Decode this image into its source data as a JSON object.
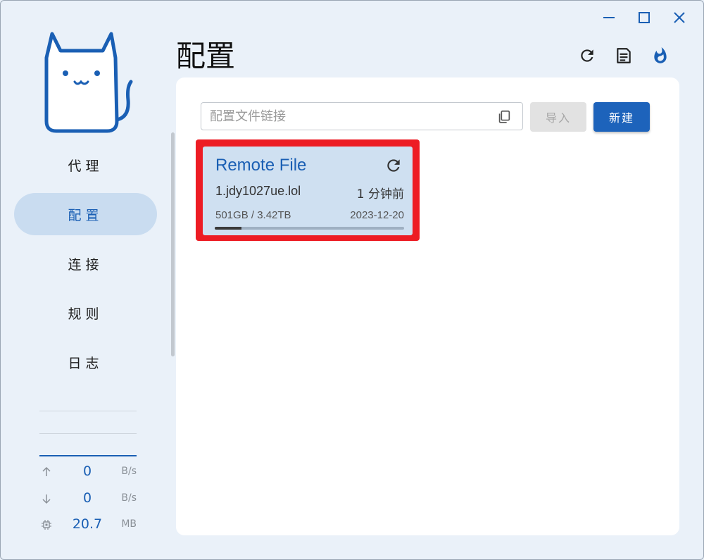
{
  "window": {
    "controls": [
      "minimize-icon",
      "maximize-icon",
      "close-icon"
    ]
  },
  "sidebar": {
    "items": [
      {
        "label": "代理",
        "active": false
      },
      {
        "label": "配置",
        "active": true
      },
      {
        "label": "连接",
        "active": false
      },
      {
        "label": "规则",
        "active": false
      },
      {
        "label": "日志",
        "active": false
      }
    ],
    "stats": {
      "upload": {
        "value": "0",
        "unit": "B/s"
      },
      "download": {
        "value": "0",
        "unit": "B/s"
      },
      "memory": {
        "value": "20.7",
        "unit": "MB"
      }
    }
  },
  "header": {
    "title": "配置",
    "actions": [
      "refresh-icon",
      "log-document-icon",
      "fire-icon"
    ]
  },
  "main": {
    "url_input": {
      "placeholder": "配置文件链接",
      "value": ""
    },
    "import_label": "导入",
    "new_label": "新建",
    "profiles": [
      {
        "name": "Remote File",
        "host": "1.jdy1027ue.lol",
        "updated": "1 分钟前",
        "usage": "501GB / 3.42TB",
        "expire": "2023-12-20",
        "usage_fraction": 0.14
      }
    ]
  },
  "colors": {
    "accent": "#1a5fb4",
    "highlight": "#ed1c24",
    "card_bg": "#cfe0f1"
  }
}
